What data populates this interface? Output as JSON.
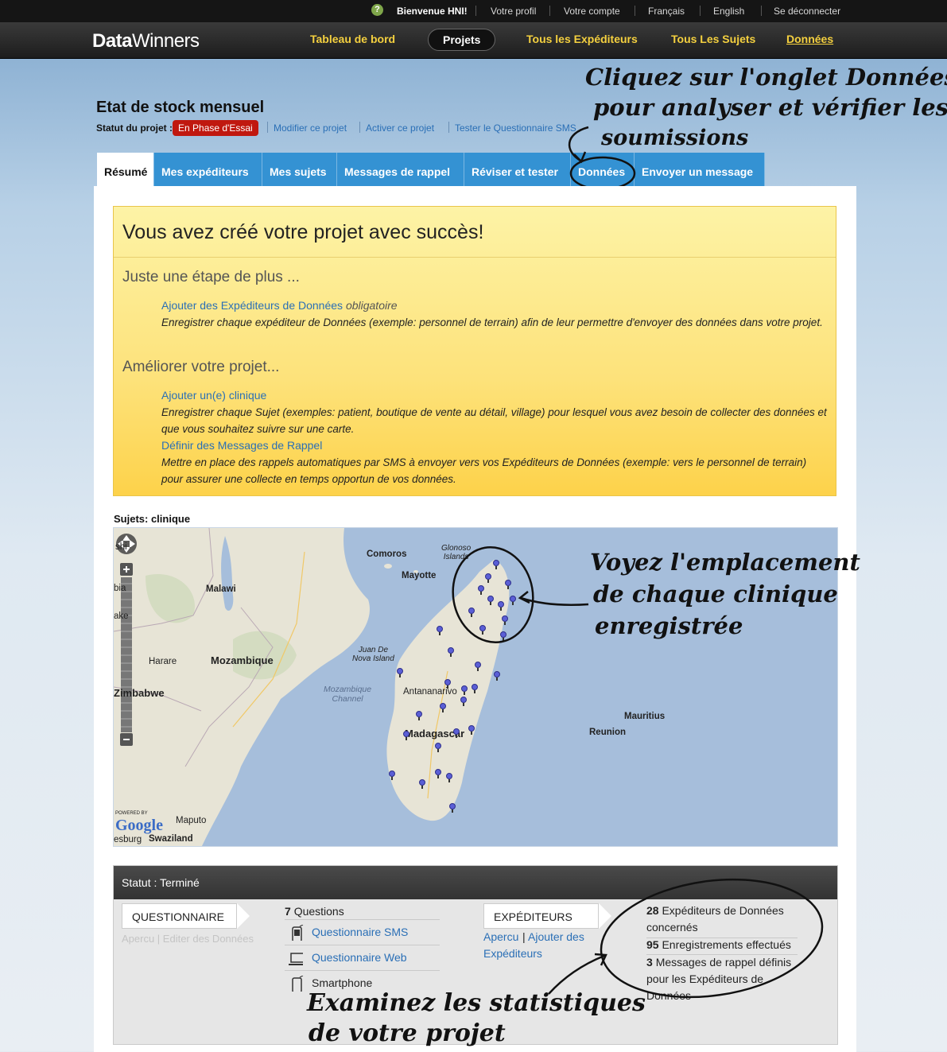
{
  "utility_bar": {
    "help_icon": "question-icon",
    "welcome": "Bienvenue HNI!",
    "items": [
      "Votre profil",
      "Votre compte",
      "Français",
      "English",
      "Se déconnecter"
    ]
  },
  "nav": {
    "logo_bold": "Data",
    "logo_rest": "Winners",
    "items": [
      "Tableau de bord",
      "Projets",
      "Tous les Expéditeurs",
      "Tous Les Sujets",
      "Données"
    ],
    "active": "Projets"
  },
  "annotations": {
    "tab_note": [
      "Cliquez sur l'onglet Données",
      "pour analyser et vérifier les",
      "soumissions"
    ],
    "map_note": [
      "Voyez l'emplacement",
      "de chaque clinique",
      "enregistrée"
    ],
    "stats_note": [
      "Examinez les statistiques",
      "de votre projet"
    ]
  },
  "project": {
    "title": "Etat de stock mensuel",
    "status_label": "Statut du projet :",
    "status_badge": "En Phase d'Essai",
    "links": [
      "Modifier ce projet",
      "Activer ce projet",
      "Tester le Questionnaire SMS"
    ]
  },
  "tabs": [
    "Résumé",
    "Mes expéditeurs",
    "Mes sujets",
    "Messages de rappel",
    "Réviser et tester",
    "Données",
    "Envoyer un message"
  ],
  "success_box": {
    "title": "Vous avez créé votre projet avec succès!",
    "step_heading": "Juste une étape de plus ...",
    "step_link": "Ajouter des Expéditeurs de Données",
    "step_link_flag": "obligatoire",
    "step_desc": "Enregistrer chaque expéditeur de Données (exemple: personnel de terrain) afin de leur permettre d'envoyer des données dans votre projet.",
    "improve_heading": "Améliorer votre projet...",
    "improve_link1": "Ajouter un(e) clinique",
    "improve_desc1": "Enregistrer chaque Sujet (exemples: patient, boutique de vente au détail, village) pour lesquel vous avez besoin de collecter des données et que vous souhaitez suivre sur une carte.",
    "improve_link2": "Définir des Messages de Rappel",
    "improve_desc2": "Mettre en place des rappels automatiques par SMS à envoyer vers vos Expéditeurs de Données (exemple: vers le personnel de terrain) pour assurer une collecte en temps opportun de vos données."
  },
  "map": {
    "label": "Sujets: clinique",
    "places": {
      "comoros": "Comoros",
      "glonoso1": "Glonoso",
      "glonoso2": "Islands",
      "mayotte": "Mayotte",
      "malawi": "Malawi",
      "mozambique": "Mozambique",
      "harare": "Harare",
      "zimbabwe": "Zimbabwe",
      "juan1": "Juan De",
      "juan2": "Nova Island",
      "channel1": "Mozambique",
      "channel2": "Channel",
      "antananarivo": "Antananarivo",
      "madagascar": "Madagascar",
      "mauritius": "Mauritius",
      "reunion": "Reunion",
      "maputo": "Maputo",
      "swaziland": "Swaziland",
      "edge_shi": "shi",
      "edge_bia": "bia",
      "edge_ake": "ake",
      "edge_esburg": "esburg"
    },
    "powered_by": "POWERED BY",
    "google": "Google"
  },
  "status_box": {
    "title": "Statut : Terminé",
    "questionnaire_label": "QUESTIONNAIRE",
    "questionnaire_links": "Apercu | Editer des Données",
    "questions_count": "7",
    "questions_label": "Questions",
    "sms_label": "Questionnaire SMS",
    "web_label": "Questionnaire Web",
    "smartphone_label": "Smartphone",
    "senders_label": "EXPÉDITEURS",
    "senders_link1": "Apercu",
    "senders_link2a": "Ajouter des",
    "senders_link2b": "Expéditeurs",
    "stat1_num": "28",
    "stat1_text_a": "Expéditeurs de Données",
    "stat1_text_b": "concernés",
    "stat2_num": "95",
    "stat2_text": "Enregistrements effectués",
    "stat3_num": "3",
    "stat3_text_a": "Messages de rappel définis",
    "stat3_text_b": "pour les Expéditeurs de",
    "stat3_text_c": "Données"
  }
}
